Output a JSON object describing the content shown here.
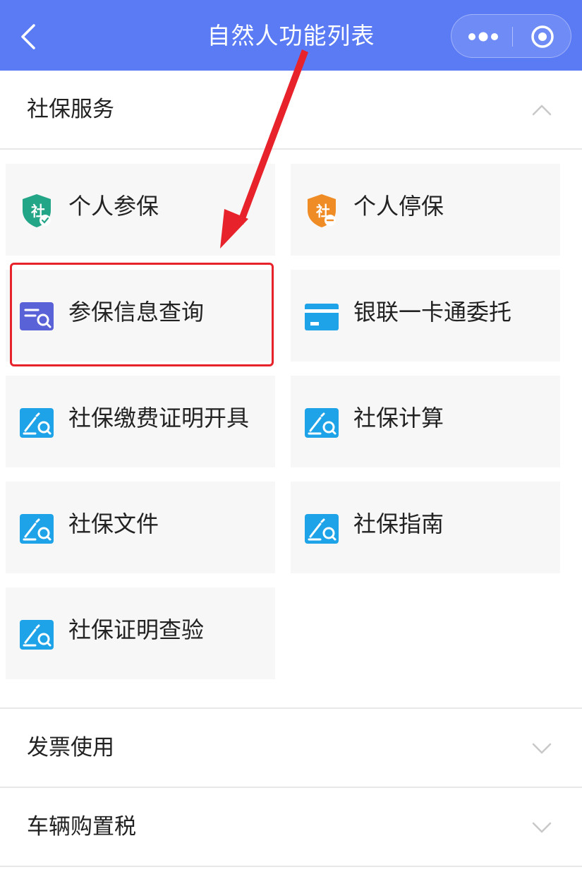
{
  "header": {
    "title": "自然人功能列表",
    "back_icon": "chevron-left-icon",
    "more_icon": "more-dots-icon",
    "close_icon": "target-circle-icon",
    "background": "#5b7bf5"
  },
  "sections": {
    "social_security": {
      "title": "社保服务",
      "expanded": true,
      "tiles": [
        {
          "label": "个人参保",
          "icon": "shield-check-icon",
          "color": "#23a587"
        },
        {
          "label": "个人停保",
          "icon": "shield-minus-icon",
          "color": "#f08c26"
        },
        {
          "label": "参保信息查询",
          "icon": "list-search-icon",
          "color": "#5a62d8",
          "highlighted": true
        },
        {
          "label": "银联一卡通委托",
          "icon": "card-icon",
          "color": "#1fa3e8"
        },
        {
          "label": "社保缴费证明开具",
          "icon": "edit-search-icon",
          "color": "#1fa3e8"
        },
        {
          "label": "社保计算",
          "icon": "edit-search-icon",
          "color": "#1fa3e8"
        },
        {
          "label": "社保文件",
          "icon": "edit-search-icon",
          "color": "#1fa3e8"
        },
        {
          "label": "社保指南",
          "icon": "edit-search-icon",
          "color": "#1fa3e8"
        },
        {
          "label": "社保证明查验",
          "icon": "edit-search-icon",
          "color": "#1fa3e8"
        }
      ]
    },
    "invoice": {
      "title": "发票使用",
      "expanded": false
    },
    "vehicle_tax": {
      "title": "车辆购置税",
      "expanded": false
    }
  },
  "annotation": {
    "color": "#e8222a",
    "arrow_icon": "red-arrow-icon"
  }
}
